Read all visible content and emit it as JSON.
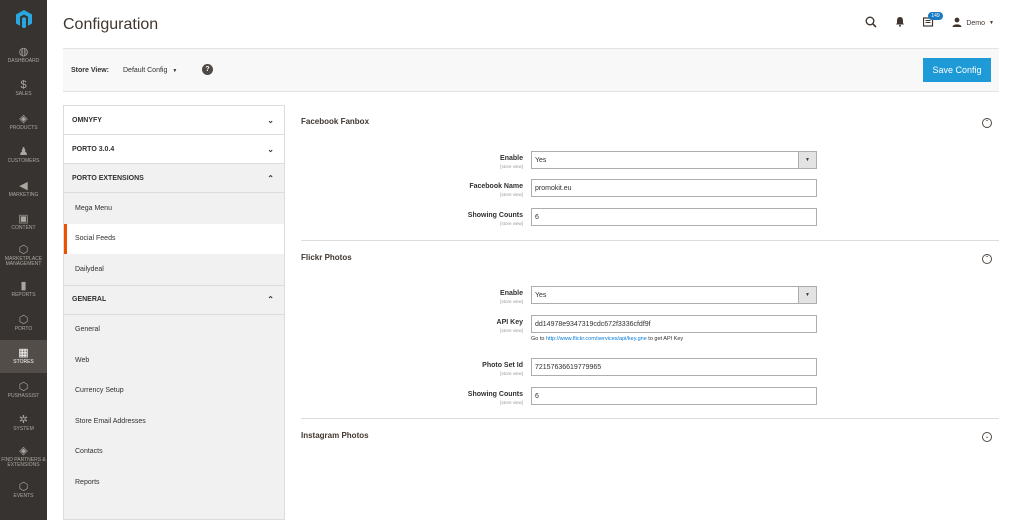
{
  "nav": {
    "logo": "magento-logo",
    "items": [
      {
        "label": "DASHBOARD",
        "icon": "dashboard-icon",
        "glyph": "◍"
      },
      {
        "label": "SALES",
        "icon": "dollar-icon",
        "glyph": "$"
      },
      {
        "label": "PRODUCTS",
        "icon": "cube-icon",
        "glyph": "◈"
      },
      {
        "label": "CUSTOMERS",
        "icon": "person-icon",
        "glyph": "♟"
      },
      {
        "label": "MARKETING",
        "icon": "megaphone-icon",
        "glyph": "◀"
      },
      {
        "label": "CONTENT",
        "icon": "content-icon",
        "glyph": "▣"
      },
      {
        "label": "MARKETPLACE MANAGEMENT",
        "icon": "hexagon-icon",
        "glyph": "⬡"
      },
      {
        "label": "REPORTS",
        "icon": "bar-chart-icon",
        "glyph": "▮"
      },
      {
        "label": "PORTO",
        "icon": "hexagon-icon",
        "glyph": "⬡"
      },
      {
        "label": "STORES",
        "icon": "store-icon",
        "glyph": "▦"
      },
      {
        "label": "PUSHASSIST",
        "icon": "hexagon-icon",
        "glyph": "⬡"
      },
      {
        "label": "SYSTEM",
        "icon": "gear-icon",
        "glyph": "✲"
      },
      {
        "label": "FIND PARTNERS & EXTENSIONS",
        "icon": "cube-icon",
        "glyph": "◈"
      },
      {
        "label": "EVENTS",
        "icon": "hexagon-icon",
        "glyph": "⬡"
      }
    ],
    "active_index": 9
  },
  "header": {
    "title": "Configuration",
    "notification_count": "149",
    "user": "Demo"
  },
  "store_bar": {
    "label": "Store View:",
    "value": "Default Config",
    "save_label": "Save Config"
  },
  "tabs": {
    "omnyfy": "OMNYFY",
    "porto": "PORTO 3.0.4",
    "porto_ext": "PORTO EXTENSIONS",
    "porto_ext_items": [
      "Mega Menu",
      "Social Feeds",
      "Dailydeal"
    ],
    "general": "GENERAL",
    "general_items": [
      "General",
      "Web",
      "Currency Setup",
      "Store Email Addresses",
      "Contacts",
      "Reports"
    ]
  },
  "facebook": {
    "title": "Facebook Fanbox",
    "enable_label": "Enable",
    "enable_value": "Yes",
    "name_label": "Facebook Name",
    "name_value": "promokit.eu",
    "counts_label": "Showing Counts",
    "counts_value": "6",
    "scope": "[store view]"
  },
  "flickr": {
    "title": "Flickr Photos",
    "enable_label": "Enable",
    "enable_value": "Yes",
    "api_label": "API Key",
    "api_value": "dd14978e9347319cdc672f3336cfdf9f",
    "note_prefix": "Go to ",
    "note_link": "http://www.flickr.com/services/api/key.gne",
    "note_suffix": " to get API Key",
    "photoset_label": "Photo Set Id",
    "photoset_value": "72157636619779965",
    "counts_label": "Showing Counts",
    "counts_value": "6",
    "scope": "[store view]"
  },
  "instagram": {
    "title": "Instagram Photos"
  },
  "colors": {
    "accent": "#eb5202",
    "button": "#1e9ad6",
    "nav_bg": "#373330",
    "link": "#007bdb"
  }
}
